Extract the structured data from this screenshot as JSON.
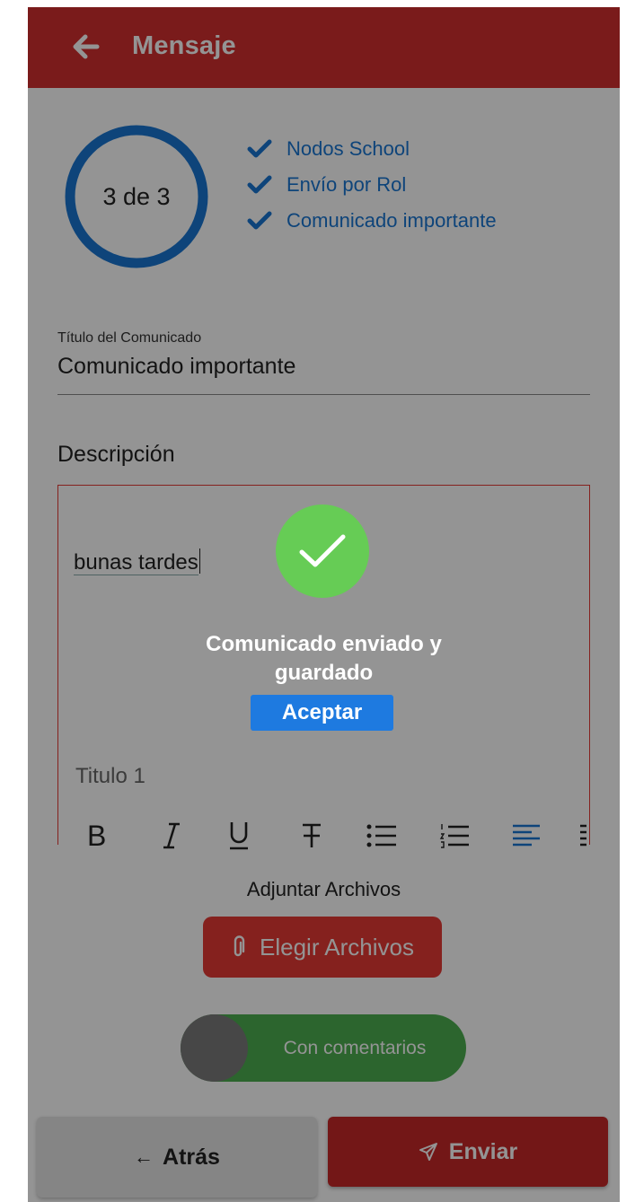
{
  "app_bar": {
    "title": "Mensaje"
  },
  "progress": {
    "text": "3 de 3",
    "fraction": 1.0,
    "color": "#1976d2",
    "steps": [
      {
        "label": "Nodos School",
        "done": true
      },
      {
        "label": "Envío por Rol",
        "done": true
      },
      {
        "label": "Comunicado importante",
        "done": true
      }
    ]
  },
  "form": {
    "title_label": "Título del Comunicado",
    "title_value": "Comunicado importante",
    "description_label": "Descripción",
    "editor_text": "bunas tardes",
    "heading_option": "Titulo 1",
    "toolbar_icons": [
      "bold-icon",
      "italic-icon",
      "underline-icon",
      "strikethrough-icon",
      "bullet-list-icon",
      "numbered-list-icon",
      "align-left-icon",
      "more-icon"
    ]
  },
  "attachments": {
    "label": "Adjuntar Archivos",
    "choose_label": "Elegir Archivos"
  },
  "comments_toggle": {
    "label": "Con comentarios",
    "on": true
  },
  "footer": {
    "back_label": "Atrás",
    "send_label": "Enviar"
  },
  "dialog": {
    "message": "Comunicado enviado y guardado",
    "accept_label": "Aceptar"
  },
  "colors": {
    "primary": "#d32f2f",
    "accent": "#1976d2",
    "success": "#66cc55",
    "toggle": "#4caf50"
  }
}
